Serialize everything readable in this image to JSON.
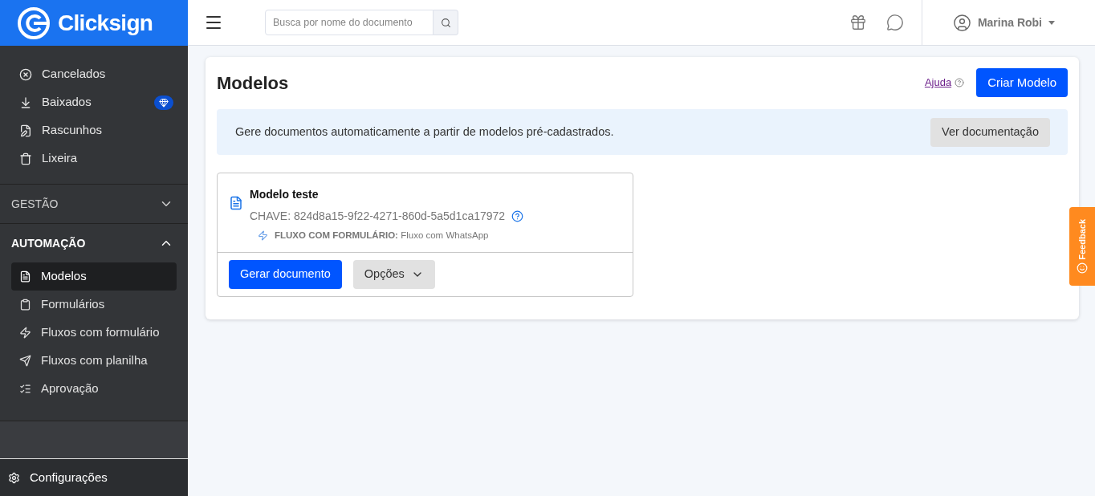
{
  "brand": {
    "name": "Clicksign"
  },
  "sidebar": {
    "items": [
      {
        "label": "Cancelados"
      },
      {
        "label": "Baixados"
      },
      {
        "label": "Rascunhos"
      },
      {
        "label": "Lixeira"
      }
    ],
    "sections": [
      {
        "title": "GESTÃO",
        "expanded": false
      },
      {
        "title": "AUTOMAÇÃO",
        "expanded": true,
        "items": [
          {
            "label": "Modelos",
            "selected": true
          },
          {
            "label": "Formulários",
            "selected": false
          },
          {
            "label": "Fluxos com formulário",
            "selected": false
          },
          {
            "label": "Fluxos com planilha",
            "selected": false
          },
          {
            "label": "Aprovação",
            "selected": false
          }
        ]
      }
    ],
    "footer": "Configurações"
  },
  "topbar": {
    "search": {
      "placeholder": "Busca por nome do documento"
    },
    "user": "Marina Robi"
  },
  "page": {
    "title": "Modelos",
    "help_link": "Ajuda",
    "create_button": "Criar Modelo",
    "banner": {
      "text": "Gere documentos automaticamente a partir de modelos pré-cadastrados.",
      "button": "Ver documentação"
    },
    "models": [
      {
        "name": "Modelo teste",
        "key": "CHAVE: 824d8a15-9f22-4271-860d-5a5d1ca17972",
        "flow_label": "FLUXO COM FORMULÁRIO:",
        "flow": "Fluxo com WhatsApp",
        "primary_button": "Gerar documento",
        "options_button": "Opções"
      }
    ]
  },
  "feedback": "Feedback"
}
